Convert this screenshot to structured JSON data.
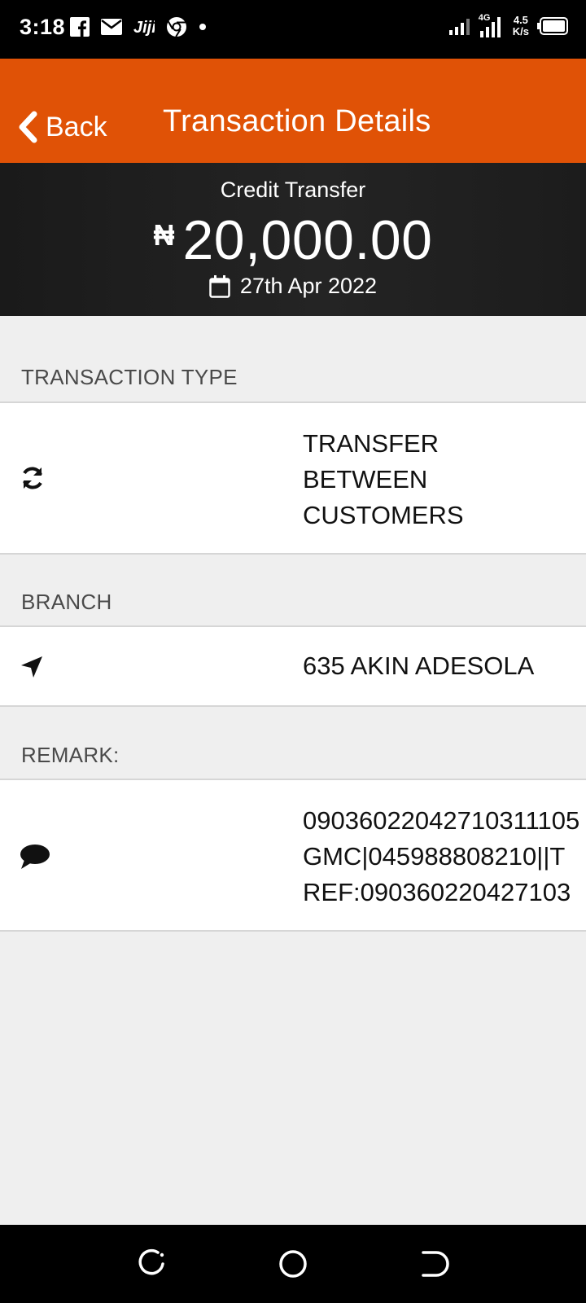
{
  "status_bar": {
    "time": "3:18",
    "left_icons": [
      "facebook-icon",
      "mail-icon",
      "jiji-icon",
      "chrome-icon",
      "dot-icon"
    ],
    "network_label": "4G",
    "speed_value": "4.5",
    "speed_unit": "K/s"
  },
  "header": {
    "back_label": "Back",
    "title": "Transaction Details",
    "background_color": "#e05206"
  },
  "summary": {
    "type": "Credit Transfer",
    "currency_symbol": "₦",
    "amount": "20,000.00",
    "date": "27th Apr 2022"
  },
  "sections": {
    "transaction_type": {
      "label": "TRANSACTION TYPE",
      "icon": "refresh-icon",
      "lines": [
        "TRANSFER",
        "BETWEEN",
        "CUSTOMERS"
      ]
    },
    "branch": {
      "label": "BRANCH",
      "icon": "location-arrow-icon",
      "value": "635 AKIN ADESOLA"
    },
    "remark": {
      "label": "REMARK:",
      "icon": "comment-icon",
      "lines": [
        "09036022042710311105",
        "GMC|045988808210||T",
        "REF:090360220427103"
      ]
    }
  },
  "nav_bar": {
    "buttons": [
      "recents-button",
      "home-button",
      "back-nav-button"
    ]
  }
}
